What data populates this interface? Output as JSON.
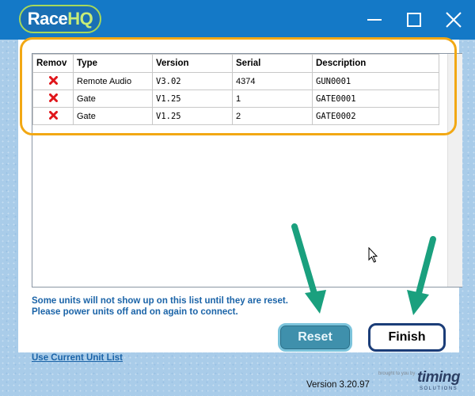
{
  "app": {
    "logo_race": "Race",
    "logo_hq": "HQ",
    "window_buttons": [
      "minimize-icon",
      "maximize-icon",
      "close-icon"
    ]
  },
  "unit_list": {
    "columns": [
      "Remov",
      "Type",
      "Version",
      "Serial",
      "Description"
    ],
    "rows": [
      {
        "remove_icon": "red-x-icon",
        "type": "Remote Audio",
        "version": "V3.02",
        "serial": "4374",
        "description": "GUN0001"
      },
      {
        "remove_icon": "red-x-icon",
        "type": "Gate",
        "version": "V1.25",
        "serial": "1",
        "description": "GATE0001"
      },
      {
        "remove_icon": "red-x-icon",
        "type": "Gate",
        "version": "V1.25",
        "serial": "2",
        "description": "GATE0002"
      }
    ]
  },
  "message": {
    "line1": "Some units will not show up on this list until they are reset.",
    "line2": "Please power units off and on again to connect."
  },
  "buttons": {
    "reset_label": "Reset",
    "finish_label": "Finish"
  },
  "link": {
    "use_current_label": "Use Current Unit List"
  },
  "footer": {
    "version": "Version 3.20.97",
    "brought_by": "brought to you by",
    "brand_word": "timing",
    "brand_sub": "SOLUTIONS"
  },
  "colors": {
    "titlebar": "#1479c7",
    "highlight": "#f2a814",
    "arrow": "#1aa07e",
    "link_text": "#1b64a8",
    "remove_x": "#e0161b"
  }
}
